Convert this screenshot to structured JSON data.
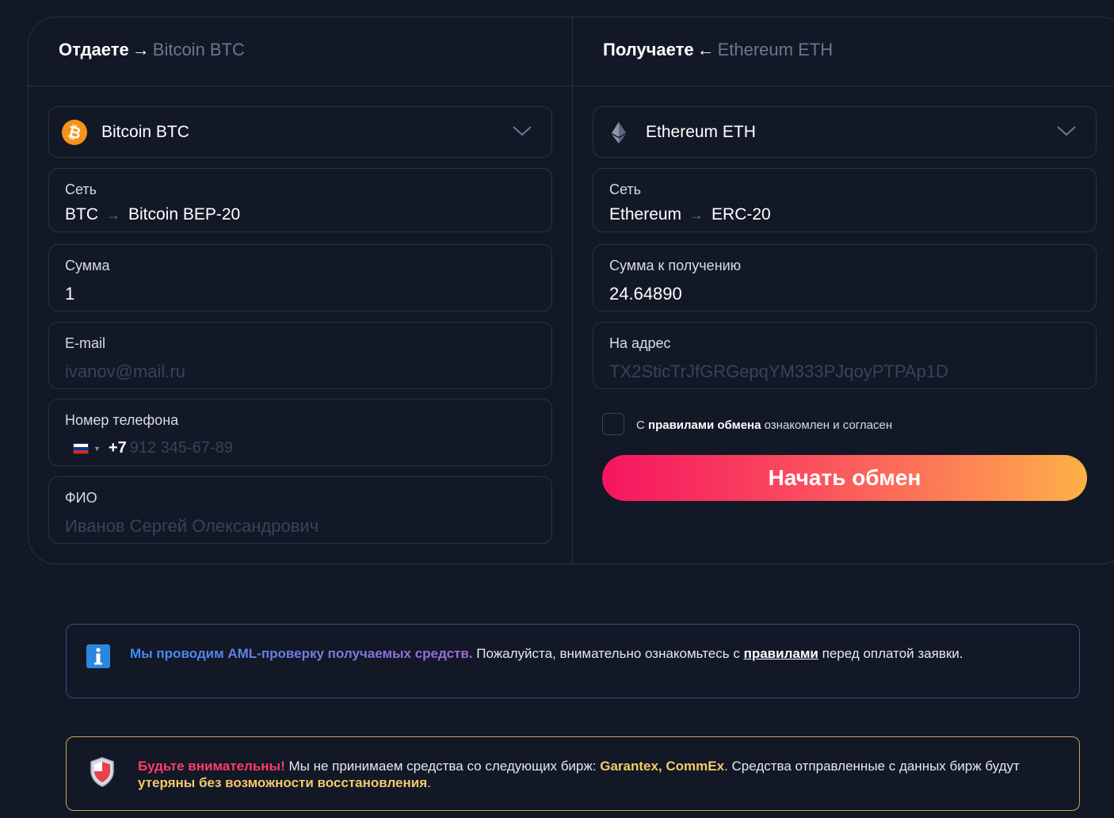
{
  "give": {
    "title": "Отдаете",
    "arrow": "→",
    "currency": "Bitcoin BTC",
    "coin_select": {
      "label": "Bitcoin BTC",
      "icon": "bitcoin-icon",
      "color": "#f7931a"
    },
    "network": {
      "label": "Сеть",
      "from": "BTC",
      "arrow": "→",
      "to": "Bitcoin BEP-20"
    },
    "amount": {
      "label": "Сумма",
      "value": "1"
    },
    "email": {
      "label": "E-mail",
      "placeholder": "ivanov@mail.ru"
    },
    "phone": {
      "label": "Номер телефона",
      "country_flag": "ru-flag-icon",
      "code": "+7",
      "placeholder": "912 345-67-89"
    },
    "fio": {
      "label": "ФИО",
      "placeholder": "Иванов Сергей Олександрович"
    }
  },
  "receive": {
    "title": "Получаете",
    "arrow": "←",
    "currency": "Ethereum ETH",
    "coin_select": {
      "label": "Ethereum ETH",
      "icon": "ethereum-icon"
    },
    "network": {
      "label": "Сеть",
      "from": "Ethereum",
      "arrow": "→",
      "to": "ERC-20"
    },
    "amount": {
      "label": "Сумма к получению",
      "value": "24.64890"
    },
    "address": {
      "label": "На адрес",
      "placeholder": "TX2SticTrJfGRGepqYM333PJqoyPTPAp1D"
    },
    "agree": {
      "prefix": "С",
      "link": "правилами обмена",
      "suffix": "ознакомлен и согласен"
    },
    "start_button": "Начать обмен"
  },
  "notices": {
    "aml": {
      "icon": "info-icon",
      "strong": "Мы проводим AML-проверку получаемых средств.",
      "text1": "Пожалуйста, внимательно ознакомьтесь с",
      "link": "правилами",
      "text2": "перед оплатой заявки."
    },
    "warning": {
      "icon": "shield-icon",
      "strong": "Будьте внимательны!",
      "text1": "Мы не принимаем средства со следующих бирж:",
      "exchanges": "Garantex, CommEx",
      "text2": ". Средства отправленные с данных бирж будут",
      "loss": "утеряны без возможности восстановления",
      "text3": "."
    }
  },
  "colors": {
    "background": "#121826",
    "border": "#2a3142",
    "accent_gradient_start": "#f5155f",
    "accent_gradient_end": "#feb047",
    "muted": "#6b7790"
  }
}
